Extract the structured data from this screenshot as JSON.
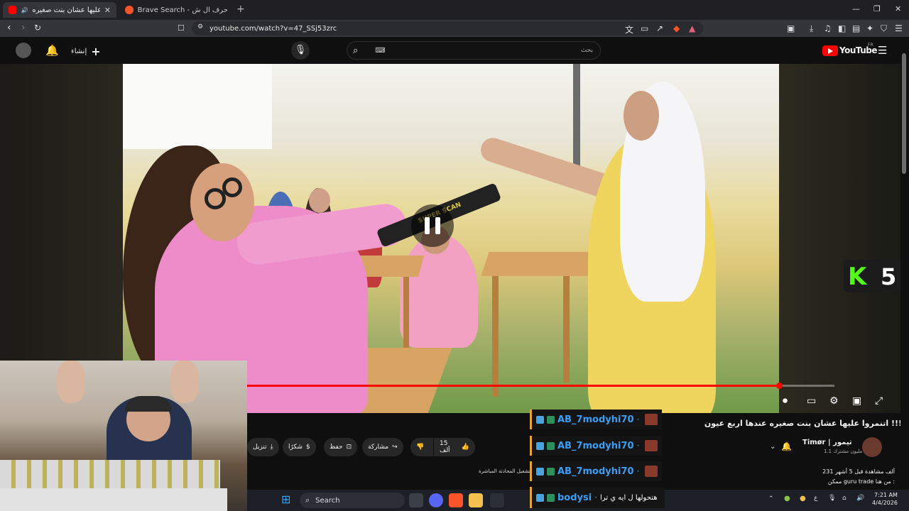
{
  "browser": {
    "tabs": [
      {
        "title": "اتنمروا عليها عشان بنت صغيره"
      },
      {
        "title": "Brave Search - بلد ب حرف ال ش"
      }
    ],
    "new_tab": "+",
    "url": "youtube.com/watch?v=47_SSj53zrc"
  },
  "youtube": {
    "logo_text": "YouTube",
    "region": "FR",
    "create_label": "إنشاء",
    "search_placeholder": "بحث"
  },
  "video": {
    "state": "playing (pause icon shown)",
    "progress_fraction": 0.906,
    "title": "اتنمروا عليها عشان بنت صغيره عندها اربع عيون !!!",
    "overlay_text": "SUPER SCAN"
  },
  "badge": {
    "letter": "K",
    "number": "5"
  },
  "actions": {
    "likes": "15 ألف",
    "share": "مشاركة",
    "save": "حفظ",
    "thanks": "شكرًا",
    "download": "تنزيل"
  },
  "channel": {
    "name": "Timør | تيمور",
    "subscribers": "1.1 مليون مشترك"
  },
  "stats": {
    "views_line": "231 ألف مشاهدة قبل 5 أشهر",
    "desc_line": "ممكن guru trade من هنا :"
  },
  "live_hint": "تشغيل المحادثة المباشرة",
  "chat": [
    {
      "user": "AB_7modyhi70",
      "text": ""
    },
    {
      "user": "AB_7modyhi70",
      "text": ""
    },
    {
      "user": "AB_7modyhi70",
      "text": ""
    },
    {
      "user": "bodysi",
      "text": "هتحولها ل ايه ي ترا"
    }
  ],
  "taskbar": {
    "search_label": "Search",
    "time": "7:21 AM",
    "date": "4/4/2026",
    "lang": "ع"
  },
  "colors": {
    "progress": "#ff0000",
    "chat_name": "#3b9ef5",
    "chat_border": "#e6a33a",
    "kick_green": "#53fc18"
  }
}
